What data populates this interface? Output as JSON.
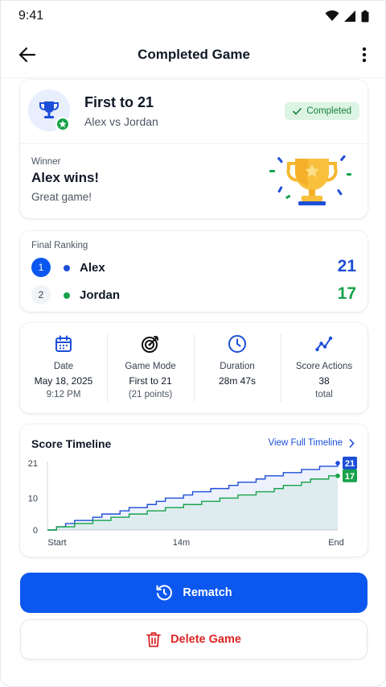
{
  "status_bar": {
    "time": "9:41"
  },
  "app_bar": {
    "title": "Completed Game"
  },
  "game": {
    "title": "First to 21",
    "matchup": "Alex vs Jordan",
    "status": "Completed",
    "winner_label": "Winner",
    "winner_name": "Alex wins!",
    "winner_message": "Great game!"
  },
  "ranking": {
    "title": "Final Ranking",
    "players": [
      {
        "rank": "1",
        "name": "Alex",
        "score": "21",
        "color": "#1d4ed8"
      },
      {
        "rank": "2",
        "name": "Jordan",
        "score": "17",
        "color": "#16a34a"
      }
    ]
  },
  "stats": [
    {
      "label": "Date",
      "value": "May 18, 2025",
      "sub": "9:12 PM",
      "icon": "calendar-icon"
    },
    {
      "label": "Game Mode",
      "value": "First to 21",
      "sub": "(21 points)",
      "icon": "target-icon"
    },
    {
      "label": "Duration",
      "value": "28m 47s",
      "sub": "",
      "icon": "clock-icon"
    },
    {
      "label": "Score Actions",
      "value": "38",
      "sub": "total",
      "icon": "trend-icon"
    }
  ],
  "timeline": {
    "title": "Score Timeline",
    "link": "View Full Timeline"
  },
  "chart_data": {
    "type": "line",
    "x_ticks": [
      "Start",
      "14m",
      "End"
    ],
    "y_ticks": [
      "21",
      "10",
      "0"
    ],
    "ylim": [
      0,
      21
    ],
    "series": [
      {
        "name": "Alex",
        "color": "#1d4ed8",
        "end_label": "21",
        "values": [
          0,
          1,
          2,
          3,
          3,
          4,
          5,
          5,
          6,
          7,
          7,
          8,
          9,
          10,
          10,
          11,
          12,
          12,
          13,
          13,
          14,
          15,
          15,
          16,
          17,
          17,
          18,
          18,
          19,
          19,
          20,
          20,
          21
        ]
      },
      {
        "name": "Jordan",
        "color": "#16a34a",
        "end_label": "17",
        "values": [
          0,
          1,
          1,
          2,
          2,
          3,
          3,
          4,
          4,
          5,
          5,
          6,
          6,
          7,
          7,
          8,
          8,
          9,
          9,
          10,
          10,
          11,
          11,
          12,
          12,
          13,
          14,
          14,
          15,
          16,
          16,
          17,
          17
        ]
      }
    ]
  },
  "buttons": {
    "rematch": "Rematch",
    "delete": "Delete Game"
  },
  "colors": {
    "primary": "#0b57f0",
    "success": "#16a34a",
    "danger": "#dc2626"
  }
}
